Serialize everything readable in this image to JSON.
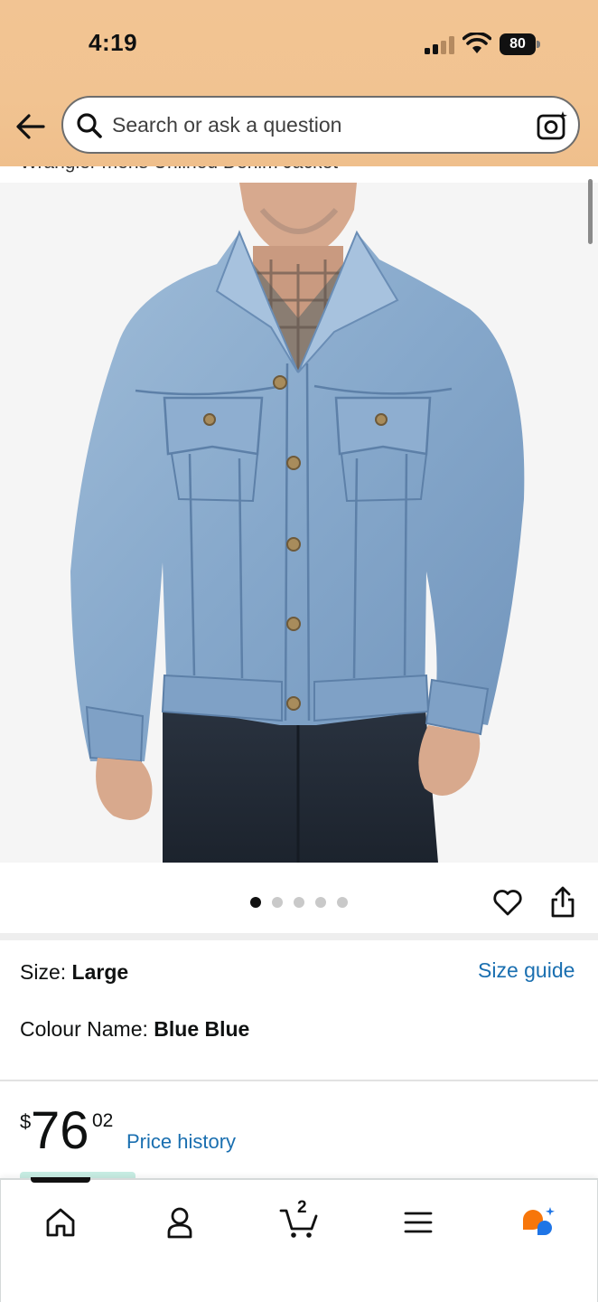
{
  "status_bar": {
    "time": "4:19",
    "battery": "80"
  },
  "header": {
    "search": {
      "placeholder": "Search or ask a question"
    },
    "icons": [
      "back-arrow-icon",
      "search-icon",
      "camera-lens-icon"
    ]
  },
  "product": {
    "title_partial": "Wrangler mens Unlined Denim Jacket",
    "carousel": {
      "image_count": 5,
      "active_index": 0
    },
    "size_label": "Size: ",
    "size_value": "Large",
    "size_guide": "Size guide",
    "colour_label": "Colour Name: ",
    "colour_value": "Blue Blue",
    "price": {
      "symbol": "$",
      "whole": "76",
      "fraction": "02"
    },
    "price_history": "Price history"
  },
  "bottom_nav": {
    "items": [
      "home-icon",
      "account-icon",
      "cart-icon",
      "menu-icon",
      "rufus-icon"
    ],
    "cart_count": "2"
  },
  "colors": {
    "header_bg": "#f2c493",
    "link": "#1a6fb0",
    "rufus_orange": "#f7760a",
    "rufus_blue": "#1f75e6"
  }
}
